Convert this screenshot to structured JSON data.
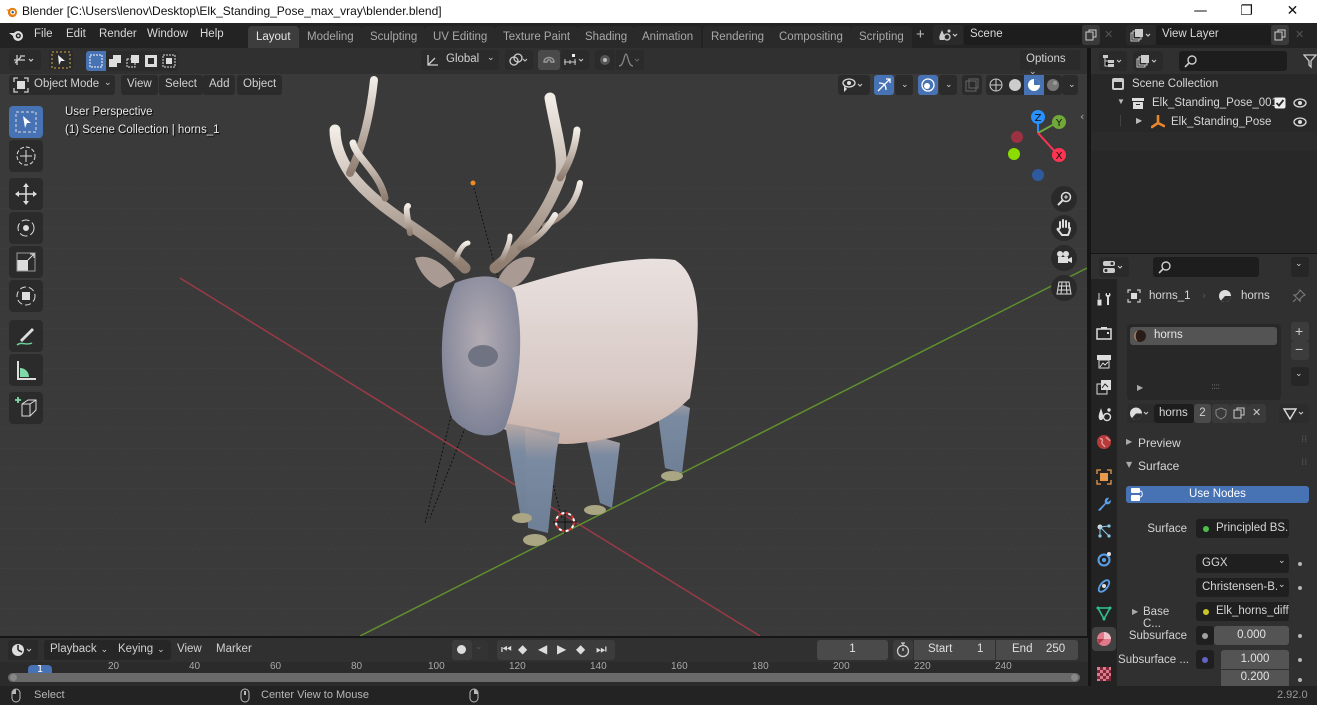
{
  "window": {
    "title": "Blender [C:\\Users\\lenov\\Desktop\\Elk_Standing_Pose_max_vray\\blender.blend]",
    "controls": {
      "minimize": "—",
      "maximize": "❐",
      "close": "✕"
    }
  },
  "menubar": {
    "items": [
      "File",
      "Edit",
      "Render",
      "Window",
      "Help"
    ]
  },
  "workspaces": {
    "tabs": [
      "Layout",
      "Modeling",
      "Sculpting",
      "UV Editing",
      "Texture Paint",
      "Shading",
      "Animation",
      "Rendering",
      "Compositing",
      "Scripting"
    ],
    "active": "Layout",
    "add_label": "+"
  },
  "scene": {
    "scene_name": "Scene",
    "view_layer": "View Layer"
  },
  "viewport": {
    "transform_orientation": "Global",
    "options_label": "Options",
    "mode": "Object Mode",
    "menus": [
      "View",
      "Select",
      "Add",
      "Object"
    ],
    "overlay_line1": "User Perspective",
    "overlay_line2": "(1) Scene Collection | horns_1",
    "gizmo_axes": {
      "x": "X",
      "y": "Y",
      "z": "Z"
    },
    "colors": {
      "x_axis": "#ff3352",
      "y_axis": "#8bdc00",
      "z_axis": "#2890ff",
      "accent": "#4772b3"
    },
    "tools": [
      "select-box",
      "cursor",
      "move",
      "rotate",
      "scale",
      "transform",
      "annotate",
      "measure",
      "add-cube"
    ]
  },
  "outliner": {
    "search_placeholder": "",
    "root": "Scene Collection",
    "items": [
      {
        "label": "Elk_Standing_Pose_001",
        "type": "collection",
        "expanded": true,
        "checked": true,
        "visible": true
      },
      {
        "label": "Elk_Standing_Pose",
        "type": "armature",
        "expanded": false,
        "visible": true
      }
    ]
  },
  "properties": {
    "search_placeholder": "",
    "breadcrumb_object": "horns_1",
    "breadcrumb_material": "horns",
    "material_slots": [
      "horns"
    ],
    "material_name": "horns",
    "material_users": "2",
    "panels": {
      "preview": "Preview",
      "surface": "Surface"
    },
    "use_nodes_label": "Use Nodes",
    "rows": [
      {
        "label": "Surface",
        "value": "Principled BS...",
        "socket_color": "#4dbf4d"
      },
      {
        "label": "",
        "value": "GGX"
      },
      {
        "label": "",
        "value": "Christensen-B..."
      },
      {
        "label": "Base C...",
        "value": "Elk_horns_diff...",
        "socket_color": "#c7c729"
      },
      {
        "label": "Subsurface",
        "value": "0.000",
        "socket_color": "#a1a1a1"
      },
      {
        "label": "Subsurface ...",
        "value": "1.000",
        "socket_color": "#6363c7"
      },
      {
        "label": "",
        "value": "0.200"
      }
    ]
  },
  "timeline": {
    "menus": [
      "Playback",
      "Keying",
      "View",
      "Marker"
    ],
    "current_frame": "1",
    "start_label": "Start",
    "start_value": "1",
    "end_label": "End",
    "end_value": "250",
    "ruler_ticks": [
      "1",
      "20",
      "40",
      "60",
      "80",
      "100",
      "120",
      "140",
      "160",
      "180",
      "200",
      "220",
      "240"
    ]
  },
  "statusbar": {
    "left_action": "Select",
    "middle_action": "Center View to Mouse",
    "version": "2.92.0"
  }
}
